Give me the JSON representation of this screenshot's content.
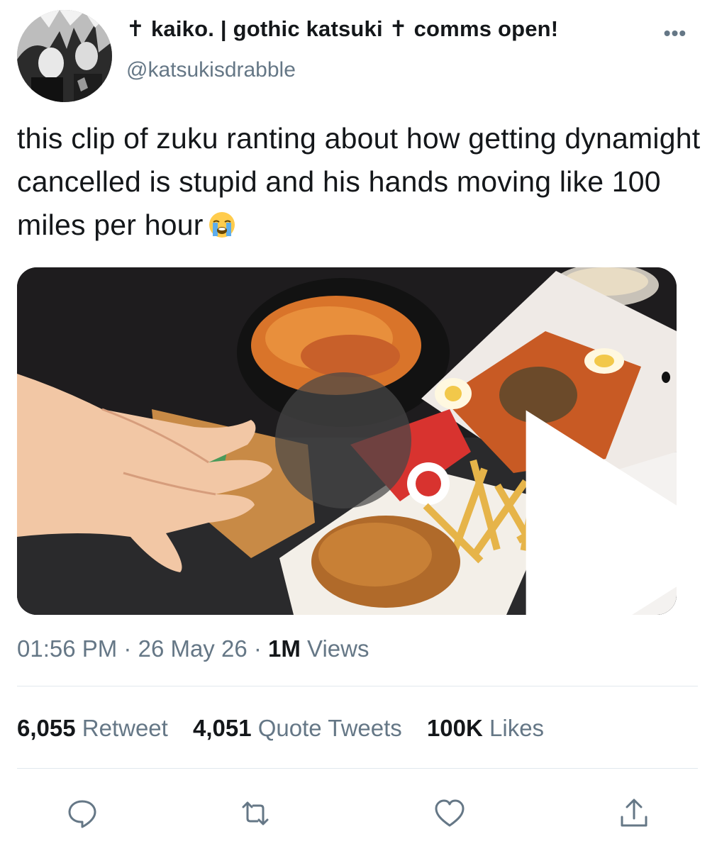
{
  "author": {
    "display_name": "✝ kaiko. | gothic katsuki ✝ comms open!",
    "handle": "@katsukisdrabble"
  },
  "tweet": {
    "text": "this clip of zuku ranting about how getting dynamight cancelled is stupid and his hands moving like 100 miles per hour",
    "emoji": "loudly-crying-face"
  },
  "meta": {
    "time": "01:56 PM",
    "separator": "·",
    "date": "26 May 26",
    "views_count": "1M",
    "views_label": "Views"
  },
  "stats": {
    "retweets_count": "6,055",
    "retweets_label": "Retweet",
    "quotes_count": "4,051",
    "quotes_label": "Quote Tweets",
    "likes_count": "100K",
    "likes_label": "Likes"
  },
  "icons": {
    "more": "more-horizontal-icon",
    "reply": "reply-icon",
    "retweet": "retweet-icon",
    "like": "heart-icon",
    "share": "share-icon",
    "play": "play-icon"
  },
  "colors": {
    "text_primary": "#14171a",
    "text_secondary": "#657786",
    "divider": "#e1e8ed"
  }
}
